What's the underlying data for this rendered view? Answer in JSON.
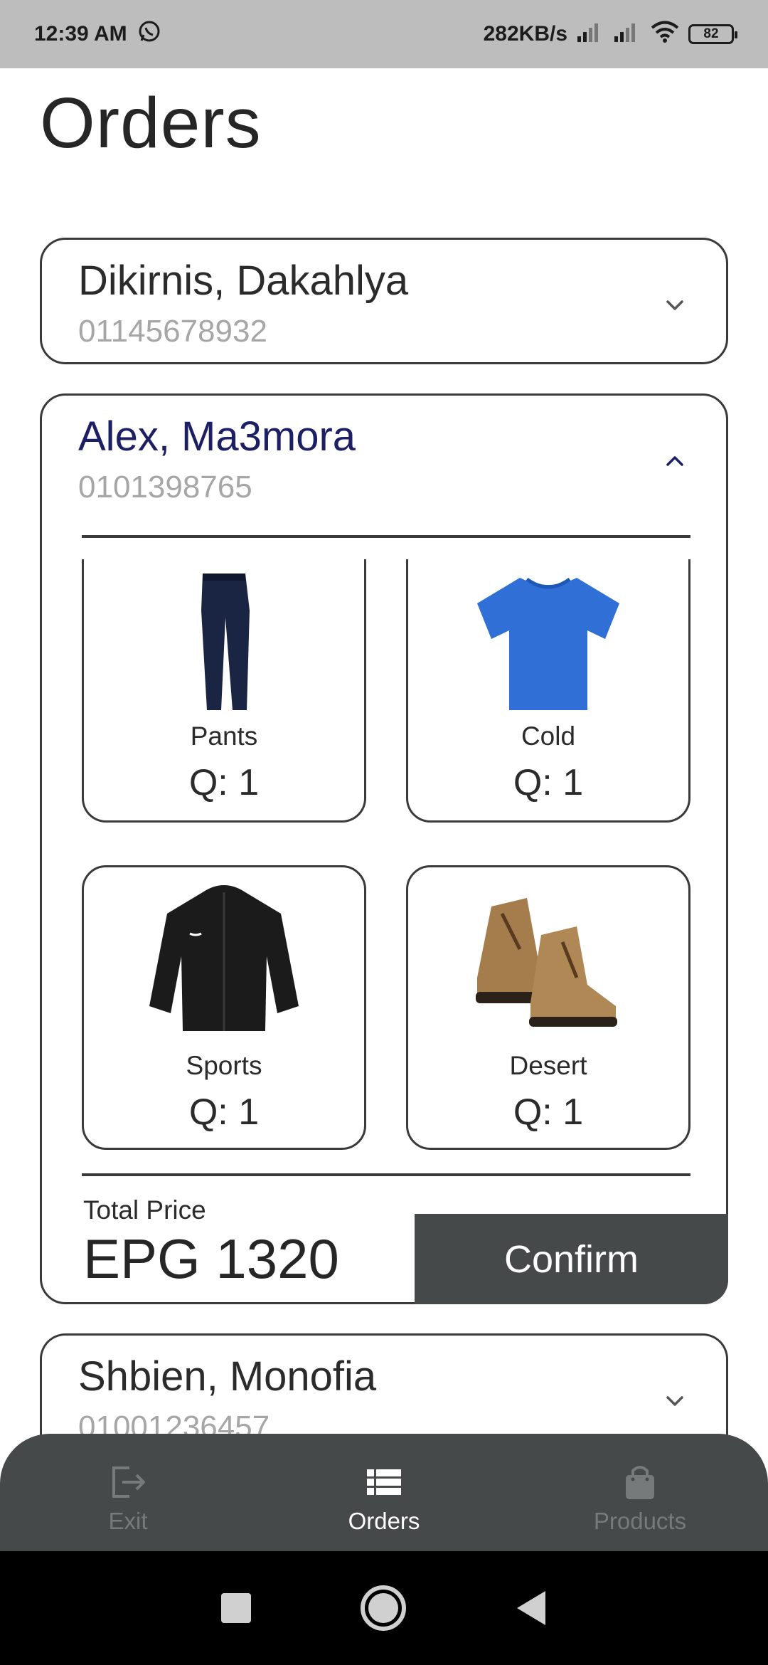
{
  "status_bar": {
    "time": "12:39 AM",
    "net_speed": "282KB/s",
    "battery": "82",
    "icons": [
      "whatsapp-icon",
      "signal-icon",
      "signal-icon",
      "wifi-icon",
      "battery-icon"
    ]
  },
  "page": {
    "title": "Orders"
  },
  "orders": [
    {
      "location": "Dikirnis, Dakahlya",
      "phone": "01145678932",
      "expanded": false
    },
    {
      "location": "Alex, Ma3mora",
      "phone": "0101398765",
      "expanded": true,
      "items": [
        {
          "name": "Pants",
          "qty": "Q: 1",
          "icon": "pants-image"
        },
        {
          "name": "Cold",
          "qty": "Q: 1",
          "icon": "tshirt-image"
        },
        {
          "name": "Sports",
          "qty": "Q: 1",
          "icon": "jacket-image"
        },
        {
          "name": "Desert",
          "qty": "Q: 1",
          "icon": "boots-image"
        }
      ],
      "total_label": "Total Price",
      "total_value": "EPG 1320",
      "confirm_label": "Confirm"
    },
    {
      "location": "Shbien, Monofia",
      "phone": "01001236457",
      "expanded": false
    }
  ],
  "bottom_nav": {
    "items": [
      {
        "label": "Exit",
        "icon": "logout-icon",
        "active": false
      },
      {
        "label": "Orders",
        "icon": "list-icon",
        "active": true
      },
      {
        "label": "Products",
        "icon": "shopping-bag-icon",
        "active": false
      }
    ]
  },
  "colors": {
    "accent_title": "#1c1f63",
    "nav_bg": "#454949",
    "status_bar_bg": "#bdbdbd"
  }
}
